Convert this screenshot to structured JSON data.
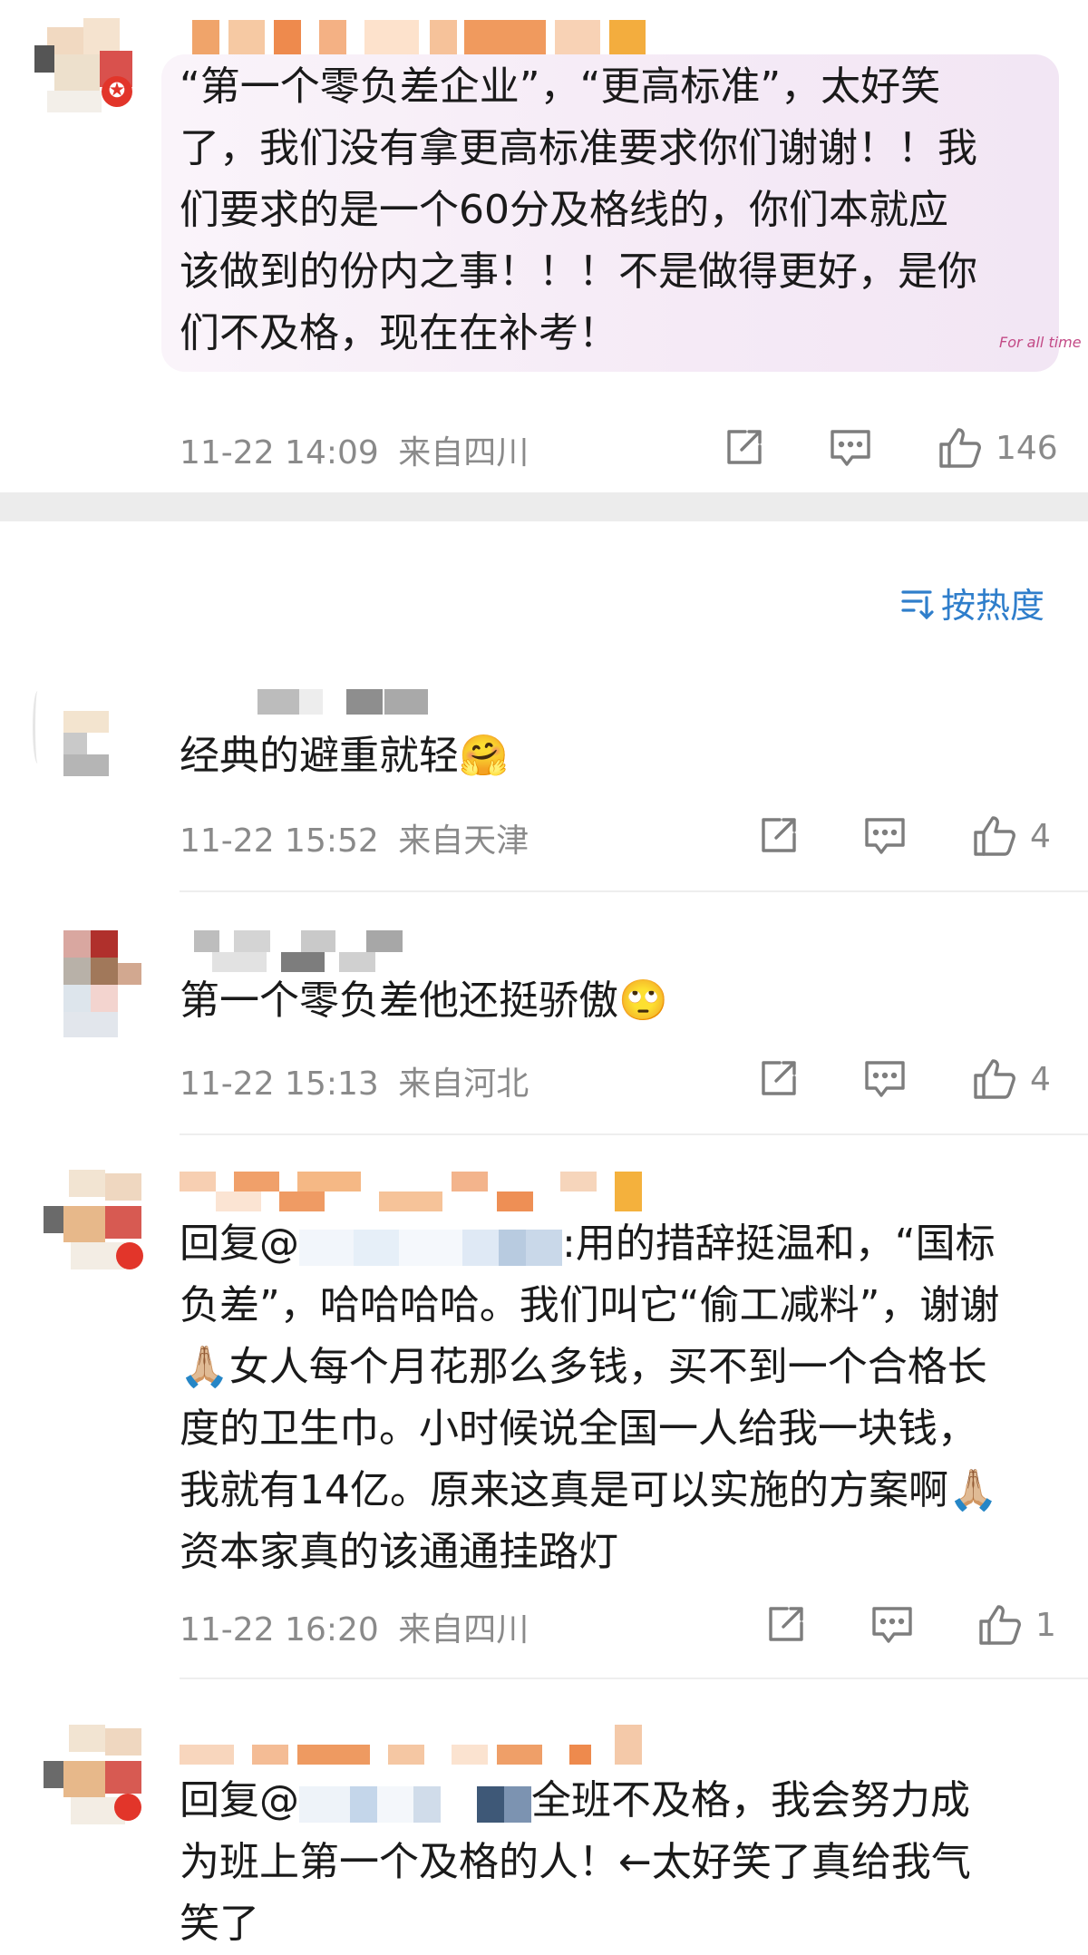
{
  "comments": [
    {
      "lines": [
        "“第一个零负差企业”，“更高标准”，太好笑",
        "了，我们没有拿更高标准要求你们谢谢！！我",
        "们要求的是一个60分及格线的，你们本就应",
        "该做到的份内之事！！！不是做得更好，是你",
        "们不及格，现在在补考！"
      ],
      "time": "11-22 14:09",
      "location": "来自四川",
      "likes": "146",
      "bubble_caption": "For all time"
    },
    {
      "lines": [
        "经典的避重就轻🤗"
      ],
      "time": "11-22 15:52",
      "location": "来自天津",
      "likes": "4"
    },
    {
      "lines": [
        "第一个零负差他还挺骄傲🙄"
      ],
      "time": "11-22 15:13",
      "location": "来自河北",
      "likes": "4"
    },
    {
      "reply_prefix": "回复@",
      "first_line_rest": ":用的措辞挺温和，“国标",
      "lines": [
        "负差”，哈哈哈哈。我们叫它“偷工减料”，谢谢",
        "🙏🏼女人每个月花那么多钱，买不到一个合格长",
        "度的卫生巾。小时候说全国一人给我一块钱，",
        "我就有14亿。原来这真是可以实施的方案啊🙏🏼",
        "资本家真的该通通挂路灯"
      ],
      "time": "11-22 16:20",
      "location": "来自四川",
      "likes": "1"
    },
    {
      "reply_prefix": "回复@",
      "first_line_rest": "全班不及格，我会努力成",
      "lines": [
        "为班上第一个及格的人！←太好笑了真给我气",
        "笑了"
      ]
    }
  ],
  "sort": {
    "label": "按热度",
    "icon": "sort-icon"
  },
  "icons": {
    "share": "share-icon",
    "comment": "comment-icon",
    "like": "thumbs-up-icon"
  },
  "colors": {
    "text": "#1a1a1a",
    "meta": "#8a8a8a",
    "bubble": "#f5eaf6",
    "accent": "#2f7ecb",
    "badge": "#e2352a"
  }
}
